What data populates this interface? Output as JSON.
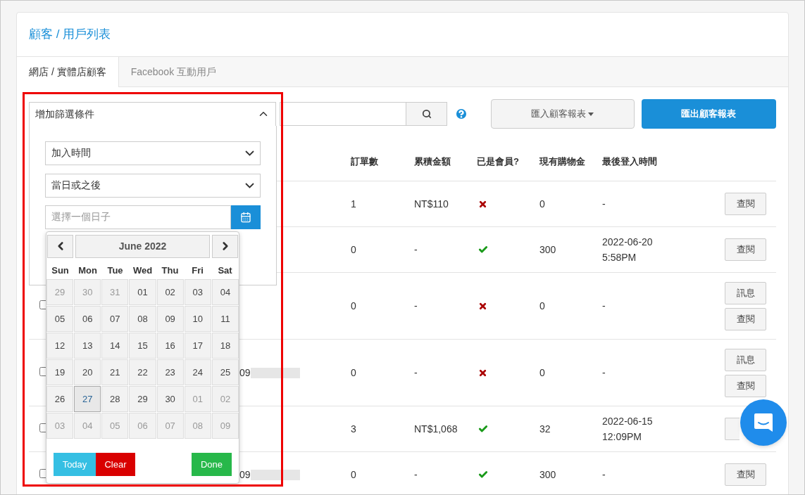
{
  "title": "顧客 / 用戶列表",
  "tabs": [
    {
      "label": "網店 / 實體店顧客",
      "selected": true
    },
    {
      "label": "Facebook 互動用戶",
      "selected": false
    }
  ],
  "filter": {
    "header": "增加篩選條件",
    "expanded": true,
    "selects": [
      "加入時間",
      "當日或之後"
    ],
    "date_placeholder": "選擇一個日子"
  },
  "calendar": {
    "month": "June 2022",
    "weekdays": [
      "Sun",
      "Mon",
      "Tue",
      "Wed",
      "Thu",
      "Fri",
      "Sat"
    ],
    "weeks": [
      [
        {
          "day": "29",
          "muted": true,
          "today": false
        },
        {
          "day": "30",
          "muted": true,
          "today": false
        },
        {
          "day": "31",
          "muted": true,
          "today": false
        },
        {
          "day": "01",
          "muted": false,
          "today": false
        },
        {
          "day": "02",
          "muted": false,
          "today": false
        },
        {
          "day": "03",
          "muted": false,
          "today": false
        },
        {
          "day": "04",
          "muted": false,
          "today": false
        }
      ],
      [
        {
          "day": "05",
          "muted": false,
          "today": false
        },
        {
          "day": "06",
          "muted": false,
          "today": false
        },
        {
          "day": "07",
          "muted": false,
          "today": false
        },
        {
          "day": "08",
          "muted": false,
          "today": false
        },
        {
          "day": "09",
          "muted": false,
          "today": false
        },
        {
          "day": "10",
          "muted": false,
          "today": false
        },
        {
          "day": "11",
          "muted": false,
          "today": false
        }
      ],
      [
        {
          "day": "12",
          "muted": false,
          "today": false
        },
        {
          "day": "13",
          "muted": false,
          "today": false
        },
        {
          "day": "14",
          "muted": false,
          "today": false
        },
        {
          "day": "15",
          "muted": false,
          "today": false
        },
        {
          "day": "16",
          "muted": false,
          "today": false
        },
        {
          "day": "17",
          "muted": false,
          "today": false
        },
        {
          "day": "18",
          "muted": false,
          "today": false
        }
      ],
      [
        {
          "day": "19",
          "muted": false,
          "today": false
        },
        {
          "day": "20",
          "muted": false,
          "today": false
        },
        {
          "day": "21",
          "muted": false,
          "today": false
        },
        {
          "day": "22",
          "muted": false,
          "today": false
        },
        {
          "day": "23",
          "muted": false,
          "today": false
        },
        {
          "day": "24",
          "muted": false,
          "today": false
        },
        {
          "day": "25",
          "muted": false,
          "today": false
        }
      ],
      [
        {
          "day": "26",
          "muted": false,
          "today": false
        },
        {
          "day": "27",
          "muted": false,
          "today": true
        },
        {
          "day": "28",
          "muted": false,
          "today": false
        },
        {
          "day": "29",
          "muted": false,
          "today": false
        },
        {
          "day": "30",
          "muted": false,
          "today": false
        },
        {
          "day": "01",
          "muted": true,
          "today": false
        },
        {
          "day": "02",
          "muted": true,
          "today": false
        }
      ],
      [
        {
          "day": "03",
          "muted": true,
          "today": false
        },
        {
          "day": "04",
          "muted": true,
          "today": false
        },
        {
          "day": "05",
          "muted": true,
          "today": false
        },
        {
          "day": "06",
          "muted": true,
          "today": false
        },
        {
          "day": "07",
          "muted": true,
          "today": false
        },
        {
          "day": "08",
          "muted": true,
          "today": false
        },
        {
          "day": "09",
          "muted": true,
          "today": false
        }
      ]
    ],
    "buttons": [
      {
        "label": "Today",
        "kind": "today"
      },
      {
        "label": "Clear",
        "kind": "clear"
      },
      {
        "label": "Done",
        "kind": "done"
      }
    ]
  },
  "import_button": "匯入顧客報表",
  "export_button": "匯出顧客報表",
  "table": {
    "columns": [
      "訂單數",
      "累積金額",
      "已是會員?",
      "現有購物金",
      "最後登入時間"
    ],
    "rows": [
      {
        "orders": "1",
        "amount": "NT$110",
        "member": false,
        "credit": "0",
        "last_login": "-",
        "actions": [
          "查閱"
        ]
      },
      {
        "orders": "0",
        "amount": "-",
        "member": true,
        "credit": "300",
        "last_login": "2022-06-20 5:58PM",
        "actions": [
          "查閱"
        ]
      },
      {
        "checked": false,
        "orders": "0",
        "amount": "-",
        "member": false,
        "credit": "0",
        "last_login": "-",
        "actions": [
          "訊息",
          "查閱"
        ]
      },
      {
        "checked": false,
        "name": "09",
        "orders": "0",
        "amount": "-",
        "member": false,
        "credit": "0",
        "last_login": "-",
        "actions": [
          "訊息",
          "查閱"
        ]
      },
      {
        "checked": false,
        "orders": "3",
        "amount": "NT$1,068",
        "member": true,
        "credit": "32",
        "last_login": "2022-06-15 12:09PM",
        "actions": [],
        "covered_action": true
      },
      {
        "checked": false,
        "name": "09",
        "orders": "0",
        "amount": "-",
        "member": true,
        "credit": "300",
        "last_login": "-",
        "actions": [
          "查閱"
        ]
      }
    ]
  }
}
